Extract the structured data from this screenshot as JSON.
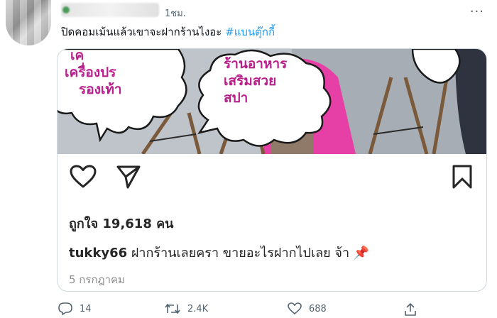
{
  "tweet": {
    "time": "1ชม.",
    "more_label": "···",
    "text": "ปิดคอมเม้นแล้วเขาจะฝากร้านไงอะ ",
    "hashtag": "#แบนตุ๊กกี้"
  },
  "card": {
    "bubble_left": [
      "เค",
      "เครื่องปร",
      "รองเท้า"
    ],
    "bubble_center": [
      "ร้านอาหาร",
      "เสริมสวย",
      "สปา"
    ],
    "likes": "ถูกใจ 19,618 คน",
    "caption_user": "tukky66",
    "caption_text": " ฝากร้านเลยครา ขายอะไรฝากไปเลย จ้า ",
    "caption_emoji": "📌",
    "date": "5 กรกฎาคม"
  },
  "footer": {
    "replies": "14",
    "retweets": "2.4K",
    "likes": "688"
  },
  "icons": [
    "user-avatar",
    "more-icon",
    "heart-icon",
    "share-icon",
    "bookmark-icon",
    "reply-icon",
    "retweet-icon",
    "like-icon",
    "share-tweet-icon"
  ],
  "colors": {
    "hashtag": "#1d9bf0",
    "secondary": "#536471",
    "bubble_text": "#b81f8c",
    "border": "#cfd9de"
  }
}
